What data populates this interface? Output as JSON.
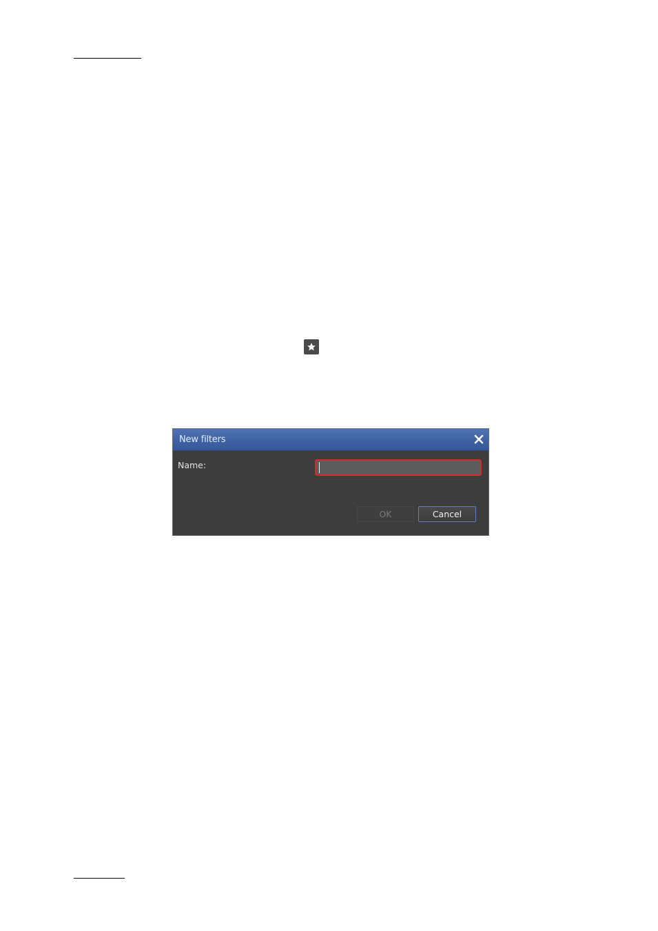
{
  "dialog": {
    "title": "New filters",
    "name_label": "Name:",
    "name_value": "",
    "ok_label": "OK",
    "cancel_label": "Cancel"
  },
  "icons": {
    "favorite": "star-icon",
    "close": "close-icon"
  },
  "colors": {
    "titlebar": "#3f62a3",
    "dialog_background": "#3d3d3d",
    "input_error_border": "#d42a2a",
    "cancel_focus_border": "#5f7fbf"
  }
}
